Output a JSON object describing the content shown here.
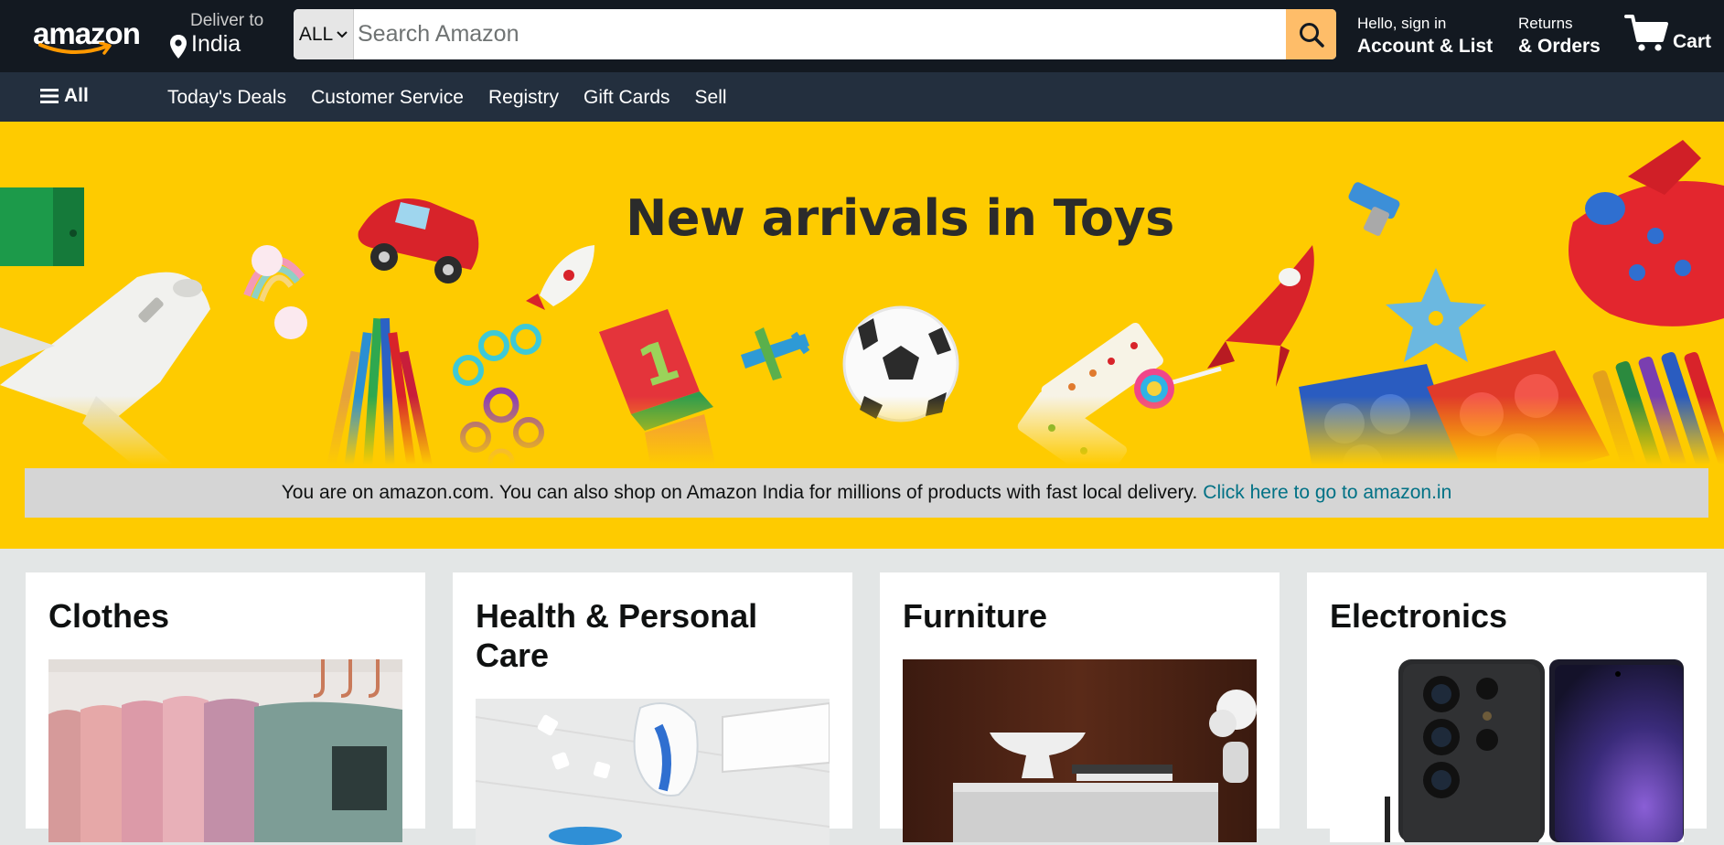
{
  "brand": {
    "logo_text": "amazon",
    "accent": "#febd69",
    "nav_bg": "#131921",
    "subnav_bg": "#232f3e",
    "hero_bg": "#fecb00",
    "link_color": "#007185"
  },
  "delivery": {
    "label": "Deliver to",
    "location": "India"
  },
  "search": {
    "category": "ALL",
    "placeholder": "Search Amazon",
    "value": "",
    "button_icon": "search-icon"
  },
  "account": {
    "greeting": "Hello, sign in",
    "label": "Account & List"
  },
  "orders": {
    "line1": "Returns",
    "line2": "& Orders"
  },
  "cart": {
    "label": "Cart",
    "icon": "cart-icon"
  },
  "subnav": {
    "all_label": "All",
    "links": [
      "Today's Deals",
      "Customer Service",
      "Registry",
      "Gift Cards",
      "Sell"
    ]
  },
  "hero": {
    "title": "New arrivals in Toys",
    "notice_text": "You are on amazon.com. You can also shop on Amazon India for millions of products with fast local delivery.",
    "notice_link": "Click here to go to amazon.in"
  },
  "categories": [
    {
      "title": "Clothes"
    },
    {
      "title": "Health & Personal Care"
    },
    {
      "title": "Furniture"
    },
    {
      "title": "Electronics"
    }
  ]
}
